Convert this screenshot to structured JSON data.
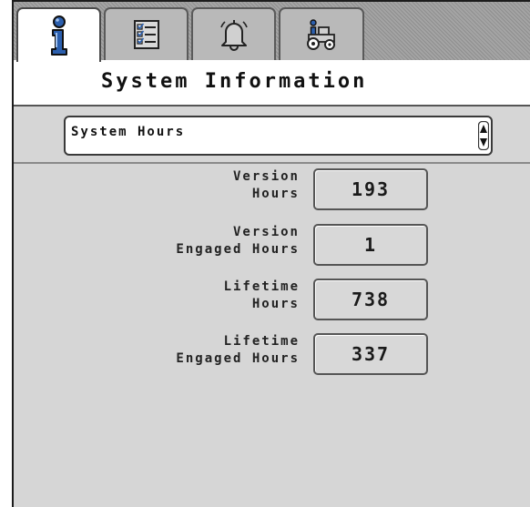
{
  "tabs": [
    {
      "icon": "info-icon",
      "active": true
    },
    {
      "icon": "checklist-icon",
      "active": false
    },
    {
      "icon": "alarm-bell-icon",
      "active": false
    },
    {
      "icon": "machine-diagnostics-icon",
      "active": false
    }
  ],
  "header": {
    "title": "System Information"
  },
  "selector": {
    "value": "System Hours"
  },
  "fields": [
    {
      "label_line1": "Version",
      "label_line2": "Hours",
      "value": "193"
    },
    {
      "label_line1": "Version",
      "label_line2": "Engaged Hours",
      "value": "1"
    },
    {
      "label_line1": "Lifetime",
      "label_line2": "Hours",
      "value": "738"
    },
    {
      "label_line1": "Lifetime",
      "label_line2": "Engaged Hours",
      "value": "337"
    }
  ],
  "colors": {
    "accent_blue": "#2b5fae",
    "panel_gray": "#d6d6d6"
  }
}
